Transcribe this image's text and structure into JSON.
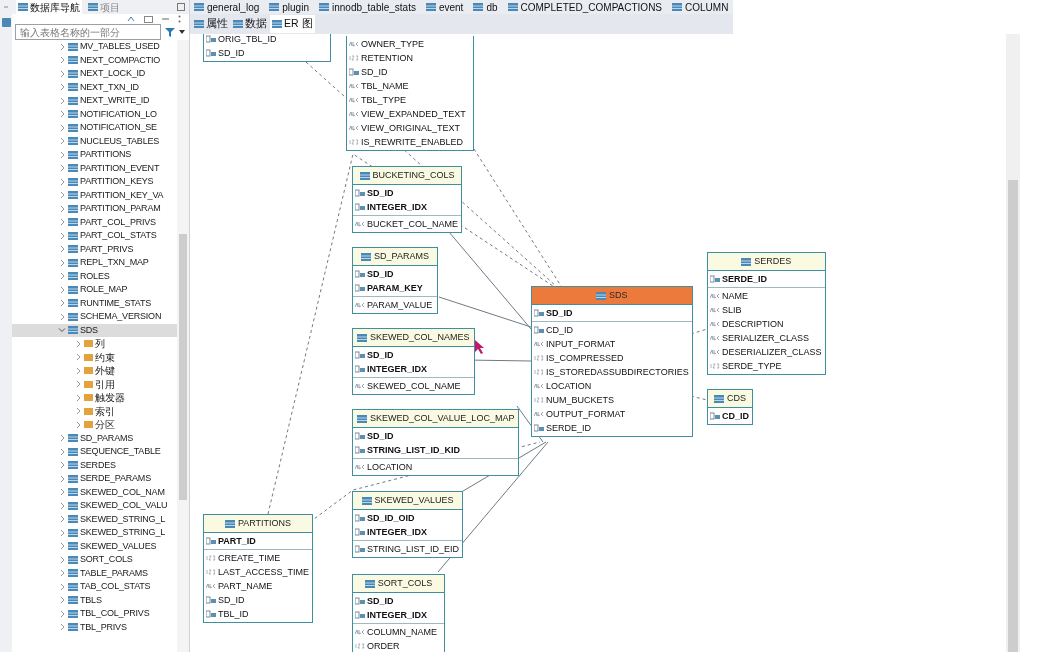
{
  "navigator": {
    "tabs": [
      {
        "label": "数据库导航",
        "selected": true
      },
      {
        "label": "项目",
        "selected": false
      }
    ],
    "search": {
      "placeholder": "输入表格名称的一部分"
    },
    "tree": [
      {
        "label": "MV_TABLES_USED",
        "kind": "table",
        "expanded": false,
        "selected": false
      },
      {
        "label": "NEXT_COMPACTIO",
        "kind": "table",
        "expanded": false,
        "selected": false
      },
      {
        "label": "NEXT_LOCK_ID",
        "kind": "table",
        "expanded": false,
        "selected": false
      },
      {
        "label": "NEXT_TXN_ID",
        "kind": "table",
        "expanded": false,
        "selected": false
      },
      {
        "label": "NEXT_WRITE_ID",
        "kind": "table",
        "expanded": false,
        "selected": false
      },
      {
        "label": "NOTIFICATION_LO",
        "kind": "table",
        "expanded": false,
        "selected": false
      },
      {
        "label": "NOTIFICATION_SE",
        "kind": "table",
        "expanded": false,
        "selected": false
      },
      {
        "label": "NUCLEUS_TABLES",
        "kind": "table",
        "expanded": false,
        "selected": false
      },
      {
        "label": "PARTITIONS",
        "kind": "table",
        "expanded": false,
        "selected": false
      },
      {
        "label": "PARTITION_EVENT",
        "kind": "table",
        "expanded": false,
        "selected": false
      },
      {
        "label": "PARTITION_KEYS",
        "kind": "table",
        "expanded": false,
        "selected": false
      },
      {
        "label": "PARTITION_KEY_VA",
        "kind": "table",
        "expanded": false,
        "selected": false
      },
      {
        "label": "PARTITION_PARAM",
        "kind": "table",
        "expanded": false,
        "selected": false
      },
      {
        "label": "PART_COL_PRIVS",
        "kind": "table",
        "expanded": false,
        "selected": false
      },
      {
        "label": "PART_COL_STATS",
        "kind": "table",
        "expanded": false,
        "selected": false
      },
      {
        "label": "PART_PRIVS",
        "kind": "table",
        "expanded": false,
        "selected": false
      },
      {
        "label": "REPL_TXN_MAP",
        "kind": "table",
        "expanded": false,
        "selected": false
      },
      {
        "label": "ROLES",
        "kind": "table",
        "expanded": false,
        "selected": false
      },
      {
        "label": "ROLE_MAP",
        "kind": "table",
        "expanded": false,
        "selected": false
      },
      {
        "label": "RUNTIME_STATS",
        "kind": "table",
        "expanded": false,
        "selected": false
      },
      {
        "label": "SCHEMA_VERSION",
        "kind": "table",
        "expanded": false,
        "selected": false
      },
      {
        "label": "SDS",
        "kind": "table",
        "expanded": true,
        "selected": true,
        "children": [
          {
            "label": "列",
            "kind": "folder",
            "expanded": false,
            "selected": false
          },
          {
            "label": "约束",
            "kind": "folder",
            "expanded": false,
            "selected": false
          },
          {
            "label": "外键",
            "kind": "folder",
            "expanded": false,
            "selected": false
          },
          {
            "label": "引用",
            "kind": "folder",
            "expanded": false,
            "selected": false
          },
          {
            "label": "触发器",
            "kind": "folder",
            "expanded": false,
            "selected": false
          },
          {
            "label": "索引",
            "kind": "folder",
            "expanded": false,
            "selected": false
          },
          {
            "label": "分区",
            "kind": "folder",
            "expanded": false,
            "selected": false
          }
        ]
      },
      {
        "label": "SD_PARAMS",
        "kind": "table",
        "expanded": false,
        "selected": false
      },
      {
        "label": "SEQUENCE_TABLE",
        "kind": "table",
        "expanded": false,
        "selected": false
      },
      {
        "label": "SERDES",
        "kind": "table",
        "expanded": false,
        "selected": false
      },
      {
        "label": "SERDE_PARAMS",
        "kind": "table",
        "expanded": false,
        "selected": false
      },
      {
        "label": "SKEWED_COL_NAM",
        "kind": "table",
        "expanded": false,
        "selected": false
      },
      {
        "label": "SKEWED_COL_VALU",
        "kind": "table",
        "expanded": false,
        "selected": false
      },
      {
        "label": "SKEWED_STRING_L",
        "kind": "table",
        "expanded": false,
        "selected": false
      },
      {
        "label": "SKEWED_STRING_L",
        "kind": "table",
        "expanded": false,
        "selected": false
      },
      {
        "label": "SKEWED_VALUES",
        "kind": "table",
        "expanded": false,
        "selected": false
      },
      {
        "label": "SORT_COLS",
        "kind": "table",
        "expanded": false,
        "selected": false
      },
      {
        "label": "TABLE_PARAMS",
        "kind": "table",
        "expanded": false,
        "selected": false
      },
      {
        "label": "TAB_COL_STATS",
        "kind": "table",
        "expanded": false,
        "selected": false
      },
      {
        "label": "TBLS",
        "kind": "table",
        "expanded": false,
        "selected": false
      },
      {
        "label": "TBL_COL_PRIVS",
        "kind": "table",
        "expanded": false,
        "selected": false
      },
      {
        "label": "TBL_PRIVS",
        "kind": "table",
        "expanded": false,
        "selected": false
      }
    ]
  },
  "editor_tabs": [
    {
      "label": "general_log"
    },
    {
      "label": "plugin"
    },
    {
      "label": "innodb_table_stats"
    },
    {
      "label": "event"
    },
    {
      "label": "db"
    },
    {
      "label": "COMPLETED_COMPACTIONS"
    },
    {
      "label": "COLUMN"
    }
  ],
  "view_tabs": [
    {
      "label": "属性",
      "selected": false
    },
    {
      "label": "数据",
      "selected": false
    },
    {
      "label": "ER 图",
      "selected": true
    }
  ],
  "diagram": {
    "entities": [
      {
        "columns": [
          {
            "name": "ORIG_TBL_ID",
            "kind": "key"
          },
          {
            "name": "SD_ID",
            "kind": "key"
          }
        ]
      },
      {
        "columns": [
          {
            "name": "OWNER_TYPE",
            "kind": "text"
          },
          {
            "name": "RETENTION",
            "kind": "number"
          },
          {
            "name": "SD_ID",
            "kind": "key"
          },
          {
            "name": "TBL_NAME",
            "kind": "text"
          },
          {
            "name": "TBL_TYPE",
            "kind": "text"
          },
          {
            "name": "VIEW_EXPANDED_TEXT",
            "kind": "text"
          },
          {
            "name": "VIEW_ORIGINAL_TEXT",
            "kind": "text"
          },
          {
            "name": "IS_REWRITE_ENABLED",
            "kind": "number"
          }
        ]
      },
      {
        "title": "BUCKETING_COLS",
        "selected": false,
        "keys": [
          {
            "name": "SD_ID",
            "kind": "key"
          },
          {
            "name": "INTEGER_IDX",
            "kind": "key"
          }
        ],
        "columns": [
          {
            "name": "BUCKET_COL_NAME",
            "kind": "text"
          }
        ]
      },
      {
        "title": "SD_PARAMS",
        "selected": false,
        "keys": [
          {
            "name": "SD_ID",
            "kind": "key"
          },
          {
            "name": "PARAM_KEY",
            "kind": "key"
          }
        ],
        "columns": [
          {
            "name": "PARAM_VALUE",
            "kind": "text"
          }
        ]
      },
      {
        "title": "SKEWED_COL_NAMES",
        "selected": false,
        "keys": [
          {
            "name": "SD_ID",
            "kind": "key"
          },
          {
            "name": "INTEGER_IDX",
            "kind": "key"
          }
        ],
        "columns": [
          {
            "name": "SKEWED_COL_NAME",
            "kind": "text"
          }
        ]
      },
      {
        "title": "SKEWED_COL_VALUE_LOC_MAP",
        "selected": false,
        "keys": [
          {
            "name": "SD_ID",
            "kind": "key"
          },
          {
            "name": "STRING_LIST_ID_KID",
            "kind": "key"
          }
        ],
        "columns": [
          {
            "name": "LOCATION",
            "kind": "text"
          }
        ]
      },
      {
        "title": "SKEWED_VALUES",
        "selected": false,
        "keys": [
          {
            "name": "SD_ID_OID",
            "kind": "key"
          },
          {
            "name": "INTEGER_IDX",
            "kind": "key"
          }
        ],
        "columns": [
          {
            "name": "STRING_LIST_ID_EID",
            "kind": "key"
          }
        ]
      },
      {
        "title": "SORT_COLS",
        "selected": false,
        "keys": [
          {
            "name": "SD_ID",
            "kind": "key"
          },
          {
            "name": "INTEGER_IDX",
            "kind": "key"
          }
        ],
        "columns": [
          {
            "name": "COLUMN_NAME",
            "kind": "text"
          },
          {
            "name": "ORDER",
            "kind": "number"
          }
        ]
      },
      {
        "title": "PARTITIONS",
        "selected": false,
        "keys": [
          {
            "name": "PART_ID",
            "kind": "key"
          }
        ],
        "columns": [
          {
            "name": "CREATE_TIME",
            "kind": "number"
          },
          {
            "name": "LAST_ACCESS_TIME",
            "kind": "number"
          },
          {
            "name": "PART_NAME",
            "kind": "text"
          },
          {
            "name": "SD_ID",
            "kind": "key"
          },
          {
            "name": "TBL_ID",
            "kind": "key"
          }
        ]
      },
      {
        "title": "SDS",
        "selected": true,
        "keys": [
          {
            "name": "SD_ID",
            "kind": "key"
          }
        ],
        "columns": [
          {
            "name": "CD_ID",
            "kind": "key"
          },
          {
            "name": "INPUT_FORMAT",
            "kind": "text"
          },
          {
            "name": "IS_COMPRESSED",
            "kind": "number"
          },
          {
            "name": "IS_STOREDASSUBDIRECTORIES",
            "kind": "number"
          },
          {
            "name": "LOCATION",
            "kind": "text"
          },
          {
            "name": "NUM_BUCKETS",
            "kind": "number"
          },
          {
            "name": "OUTPUT_FORMAT",
            "kind": "text"
          },
          {
            "name": "SERDE_ID",
            "kind": "key"
          }
        ]
      },
      {
        "title": "SERDES",
        "selected": false,
        "keys": [
          {
            "name": "SERDE_ID",
            "kind": "key"
          }
        ],
        "columns": [
          {
            "name": "NAME",
            "kind": "text"
          },
          {
            "name": "SLIB",
            "kind": "text"
          },
          {
            "name": "DESCRIPTION",
            "kind": "text"
          },
          {
            "name": "SERIALIZER_CLASS",
            "kind": "text"
          },
          {
            "name": "DESERIALIZER_CLASS",
            "kind": "text"
          },
          {
            "name": "SERDE_TYPE",
            "kind": "number"
          }
        ]
      },
      {
        "title": "CDS",
        "selected": false,
        "keys": [
          {
            "name": "CD_ID",
            "kind": "key"
          }
        ]
      }
    ]
  }
}
